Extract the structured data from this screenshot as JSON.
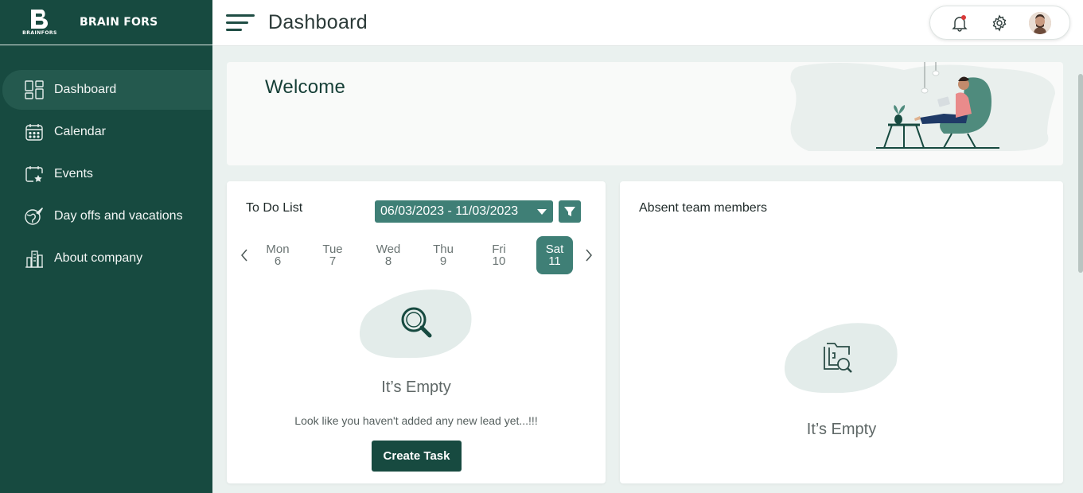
{
  "brand": {
    "logo_text": "B",
    "logo_sub": "BRAINFORS",
    "name": "BRAIN FORS"
  },
  "sidebar": {
    "items": [
      {
        "label": "Dashboard",
        "icon": "dashboard-grid-icon",
        "active": true
      },
      {
        "label": "Calendar",
        "icon": "calendar-icon",
        "active": false
      },
      {
        "label": "Events",
        "icon": "calendar-star-icon",
        "active": false
      },
      {
        "label": "Day offs and vacations",
        "icon": "globe-plane-icon",
        "active": false
      },
      {
        "label": "About company",
        "icon": "building-icon",
        "active": false
      }
    ]
  },
  "header": {
    "title": "Dashboard",
    "tools": [
      "bell-icon",
      "gear-icon",
      "user-avatar"
    ]
  },
  "welcome": {
    "title": "Welcome"
  },
  "todo": {
    "title": "To Do List",
    "date_range": "06/03/2023 - 11/03/2023",
    "days": [
      {
        "name": "Mon",
        "num": "6"
      },
      {
        "name": "Tue",
        "num": "7"
      },
      {
        "name": "Wed",
        "num": "8"
      },
      {
        "name": "Thu",
        "num": "9"
      },
      {
        "name": "Fri",
        "num": "10"
      },
      {
        "name": "Sat",
        "num": "11"
      }
    ],
    "selected_day": "Sat",
    "empty_title": "It’s Empty",
    "empty_sub": "Look like you haven't added any new lead yet...!!!",
    "create_button": "Create Task"
  },
  "absent": {
    "title": "Absent team members",
    "empty_title": "It’s Empty"
  },
  "colors": {
    "sidebar": "#174a40",
    "accent": "#3f7f76",
    "background": "#eaf1ef"
  }
}
